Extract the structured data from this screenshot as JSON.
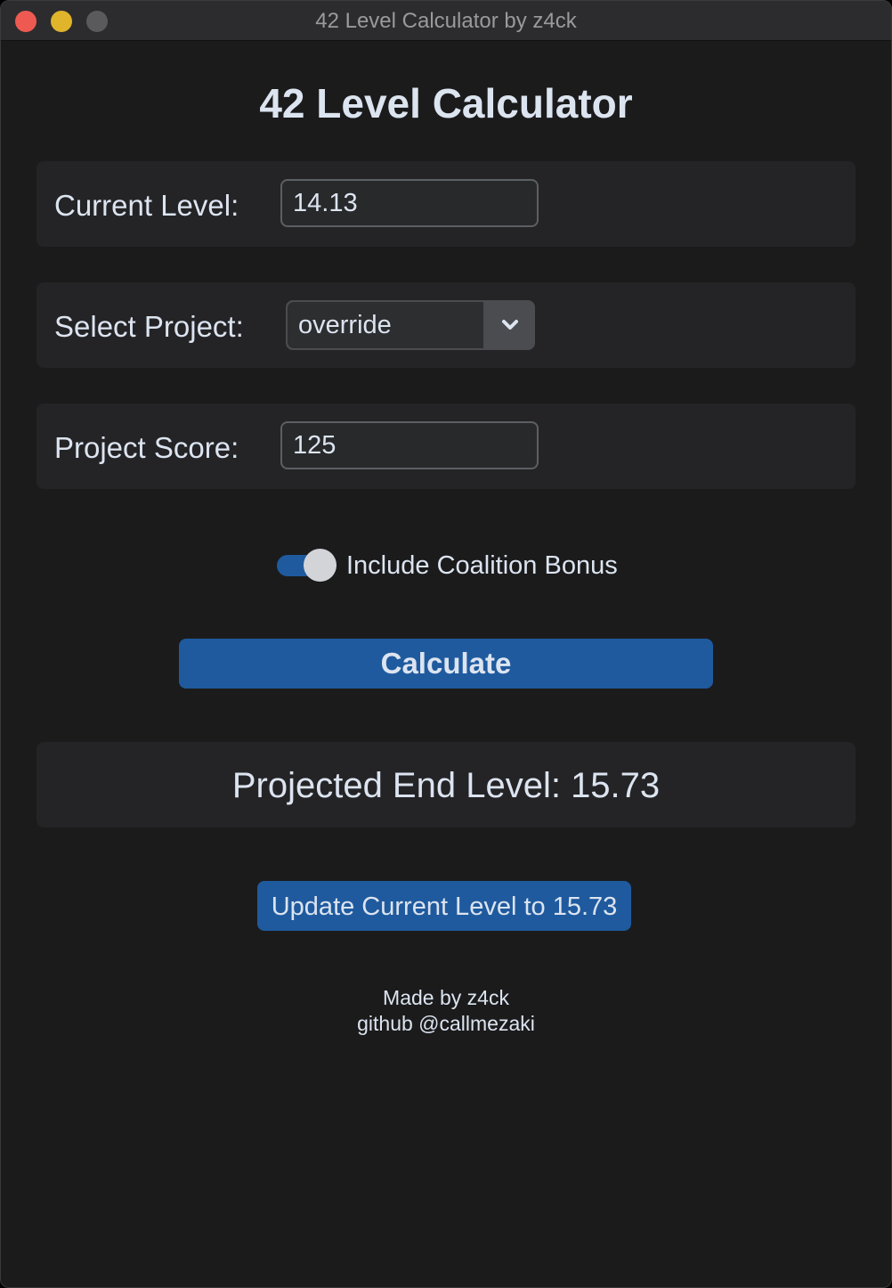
{
  "window": {
    "title": "42 Level Calculator by z4ck"
  },
  "heading": "42 Level Calculator",
  "current_level": {
    "label": "Current Level:",
    "value": "14.13"
  },
  "project": {
    "label": "Select Project:",
    "selected": "override"
  },
  "score": {
    "label": "Project Score:",
    "value": "125"
  },
  "coalition_bonus": {
    "label": "Include Coalition Bonus",
    "enabled": true
  },
  "calculate_label": "Calculate",
  "result": {
    "text": "Projected End Level: 15.73"
  },
  "update_label": "Update Current Level to 15.73",
  "footer": {
    "line1": "Made by z4ck",
    "line2": "github @callmezaki"
  },
  "colors": {
    "accent": "#1f5a9e",
    "background": "#1b1b1c",
    "panel": "#242426",
    "text": "#dce4f0"
  },
  "icons": {
    "dropdown": "chevron-down-icon"
  }
}
